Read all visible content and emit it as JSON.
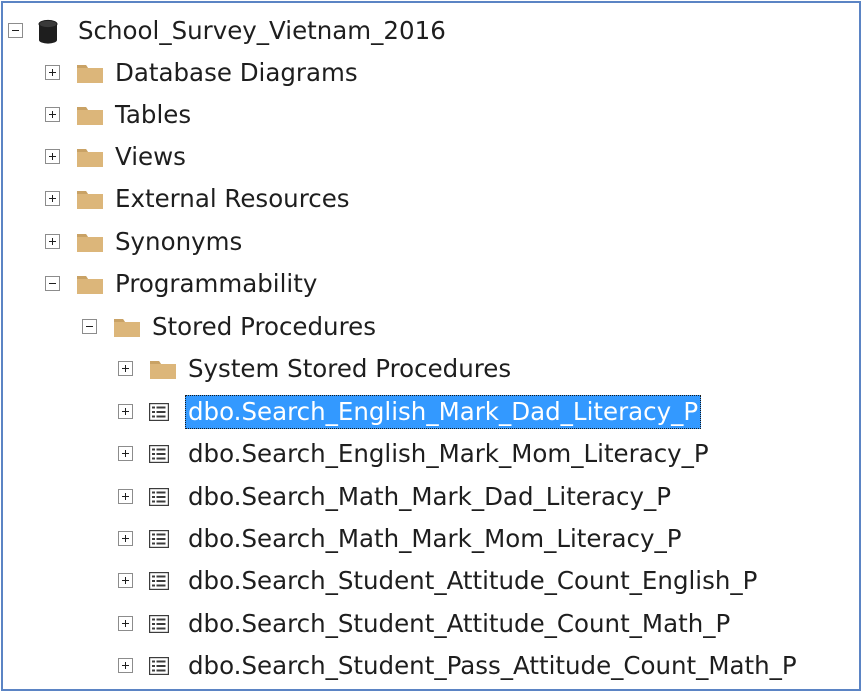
{
  "tree": {
    "root": {
      "label": "School_Survey_Vietnam_2016",
      "icon": "database-icon",
      "state": "expanded"
    },
    "nodes": {
      "database_diagrams": {
        "label": "Database Diagrams",
        "icon": "folder-icon",
        "state": "collapsed"
      },
      "tables": {
        "label": "Tables",
        "icon": "folder-icon",
        "state": "collapsed"
      },
      "views": {
        "label": "Views",
        "icon": "folder-icon",
        "state": "collapsed"
      },
      "external_resources": {
        "label": "External Resources",
        "icon": "folder-icon",
        "state": "collapsed"
      },
      "synonyms": {
        "label": "Synonyms",
        "icon": "folder-icon",
        "state": "collapsed"
      },
      "programmability": {
        "label": "Programmability",
        "icon": "folder-icon",
        "state": "expanded"
      },
      "stored_procedures": {
        "label": "Stored Procedures",
        "icon": "folder-icon",
        "state": "expanded"
      },
      "system_stored_procedures": {
        "label": "System Stored Procedures",
        "icon": "folder-icon",
        "state": "collapsed"
      }
    },
    "procedures": [
      {
        "label": "dbo.Search_English_Mark_Dad_Literacy_P",
        "icon": "stored-procedure-icon",
        "selected": true
      },
      {
        "label": "dbo.Search_English_Mark_Mom_Literacy_P",
        "icon": "stored-procedure-icon",
        "selected": false
      },
      {
        "label": "dbo.Search_Math_Mark_Dad_Literacy_P",
        "icon": "stored-procedure-icon",
        "selected": false
      },
      {
        "label": "dbo.Search_Math_Mark_Mom_Literacy_P",
        "icon": "stored-procedure-icon",
        "selected": false
      },
      {
        "label": "dbo.Search_Student_Attitude_Count_English_P",
        "icon": "stored-procedure-icon",
        "selected": false
      },
      {
        "label": "dbo.Search_Student_Attitude_Count_Math_P",
        "icon": "stored-procedure-icon",
        "selected": false
      },
      {
        "label": "dbo.Search_Student_Pass_Attitude_Count_Math_P",
        "icon": "stored-procedure-icon",
        "selected": false
      }
    ]
  },
  "colors": {
    "frame_border": "#5b84c4",
    "selection_bg": "#3399ff",
    "folder": "#dcb67a",
    "text": "#1e1e1e"
  }
}
